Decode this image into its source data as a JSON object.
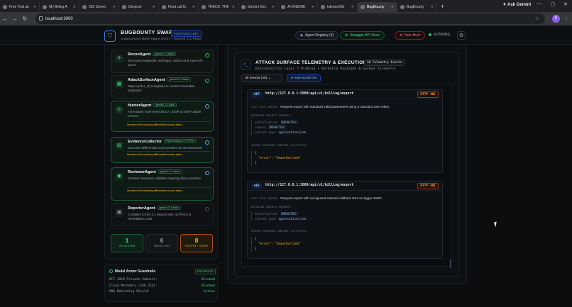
{
  "browser": {
    "tabs": [
      {
        "title": "Free Trial an"
      },
      {
        "title": "My Billing A"
      },
      {
        "title": "503 Server"
      },
      {
        "title": "Devpost"
      },
      {
        "title": "Final call fo"
      },
      {
        "title": "TRACK: THE"
      },
      {
        "title": "Gemini Dev"
      },
      {
        "title": "AI ENGINE"
      },
      {
        "title": "lokman05k"
      },
      {
        "title": "BugBounty"
      },
      {
        "title": "BugBounty"
      }
    ],
    "ask_gemini": "Ask Gemini",
    "url": "localhost:3000",
    "profile_initial": "K"
  },
  "header": {
    "brand": "BUGBOUNTY SWARM",
    "brand_badge": "FORTIFIED FLEET",
    "subtitle": "Autonomous Multi-Agent DAST • Gemini 3.1 Flash",
    "agent_registry": "Agent Registry (6)",
    "swagger": "Swagger API Docs",
    "new_hunt": "New Hunt",
    "status": "RUNNING"
  },
  "agents": [
    {
      "name": "ReconAgent",
      "model": "gemini-3.1-flash",
      "desc": "Discovers endpoints, sitemaps, robots.txt & OpenAPI specs",
      "iteration": ""
    },
    {
      "name": "AttackSurfaceAgent",
      "model": "gemini-3.1-flash",
      "desc": "Maps {order_id} templates to construct testable endpoints",
      "iteration": ""
    },
    {
      "name": "HunterAgent",
      "model": "gemini-3.1-flash",
      "desc": "Formulates multi-intent BOLA, IDOR & SSRF attack vectors",
      "iteration": "Iteration #6 executing differential access tests..."
    },
    {
      "name": "EvidenceCollector",
      "model": "Python Async / HTTPX",
      "desc": "Executes differential socket probes via SessionVault",
      "iteration": "Iteration #6 executing differential access tests..."
    },
    {
      "name": "ReviewerAgent",
      "model": "gemini-3.1-flash",
      "desc": "3-branch semantic validator rejecting false positives",
      "iteration": "Iteration #6 executing differential access tests..."
    },
    {
      "name": "ReporterAgent",
      "model": "gemini-3.1-flash",
      "desc": "Compiles CVSS 3.1 reports with curl PoCs & remediation code",
      "iteration": ""
    }
  ],
  "stats": [
    {
      "value": "1",
      "label": "VALIDATED"
    },
    {
      "value": "6",
      "label": "REJECTED"
    },
    {
      "value": "8",
      "label": "PIVOTS / ITERS"
    }
  ],
  "guardrails": {
    "title": "Model Armor Guardrails",
    "badge": "ENFORCING",
    "rows": [
      {
        "name": "RFC 1918 Private Subnets:",
        "status": "Blocked"
      },
      {
        "name": "Cloud Metadata (169.254):",
        "status": "Blocked"
      },
      {
        "name": "DNS Rebinding Shield:",
        "status": "Active"
      }
    ]
  },
  "telemetry": {
    "title": "ATTACK SURFACE TELEMETRY & EXECUTION LOG",
    "count": "30 Telemetry Events",
    "subtitle": "Deterministic Layer 7 Probing • Verbatim Payloads & Socket Telemetry",
    "filter": "All Events (30)",
    "autoscroll": "Auto-Scroll ON",
    "events": [
      {
        "method": "GET",
        "url": "http://127.0.0.1:5000/api/v1/billing/export",
        "status": "HTTP 401",
        "intent_label": "TEST STEP INTENT:",
        "intent": "Request export with standard valid parameters using a standard user token.",
        "headers_label": "OUTGOING REQUEST HEADERS:",
        "headers": [
          {
            "k": "authorization:",
            "v": "[REDACTED]"
          },
          {
            "k": "cookie:",
            "v": "[REDACTED]"
          },
          {
            "k": "content-type:",
            "v": "application/json"
          }
        ],
        "response_label": "SERVER RESPONSE CONTENT (30 BYTES):",
        "body": [
          "{",
          "\"error\": \"Unauthorized\"",
          "}"
        ]
      },
      {
        "method": "GET",
        "url": "http://127.0.0.1:5000/api/v1/billing/export",
        "status": "HTTP 401",
        "intent_label": "TEST STEP INTENT:",
        "intent": "Request export with an injected external callback URL to trigger SSRF.",
        "headers_label": "OUTGOING REQUEST HEADERS:",
        "headers": [
          {
            "k": "authorization:",
            "v": "[REDACTED]"
          },
          {
            "k": "content-type:",
            "v": "application/json"
          }
        ],
        "response_label": "SERVER RESPONSE CONTENT (30 BYTES):",
        "body": [
          "{",
          "\"error\": \"Unauthorized\"",
          "}"
        ]
      }
    ]
  }
}
